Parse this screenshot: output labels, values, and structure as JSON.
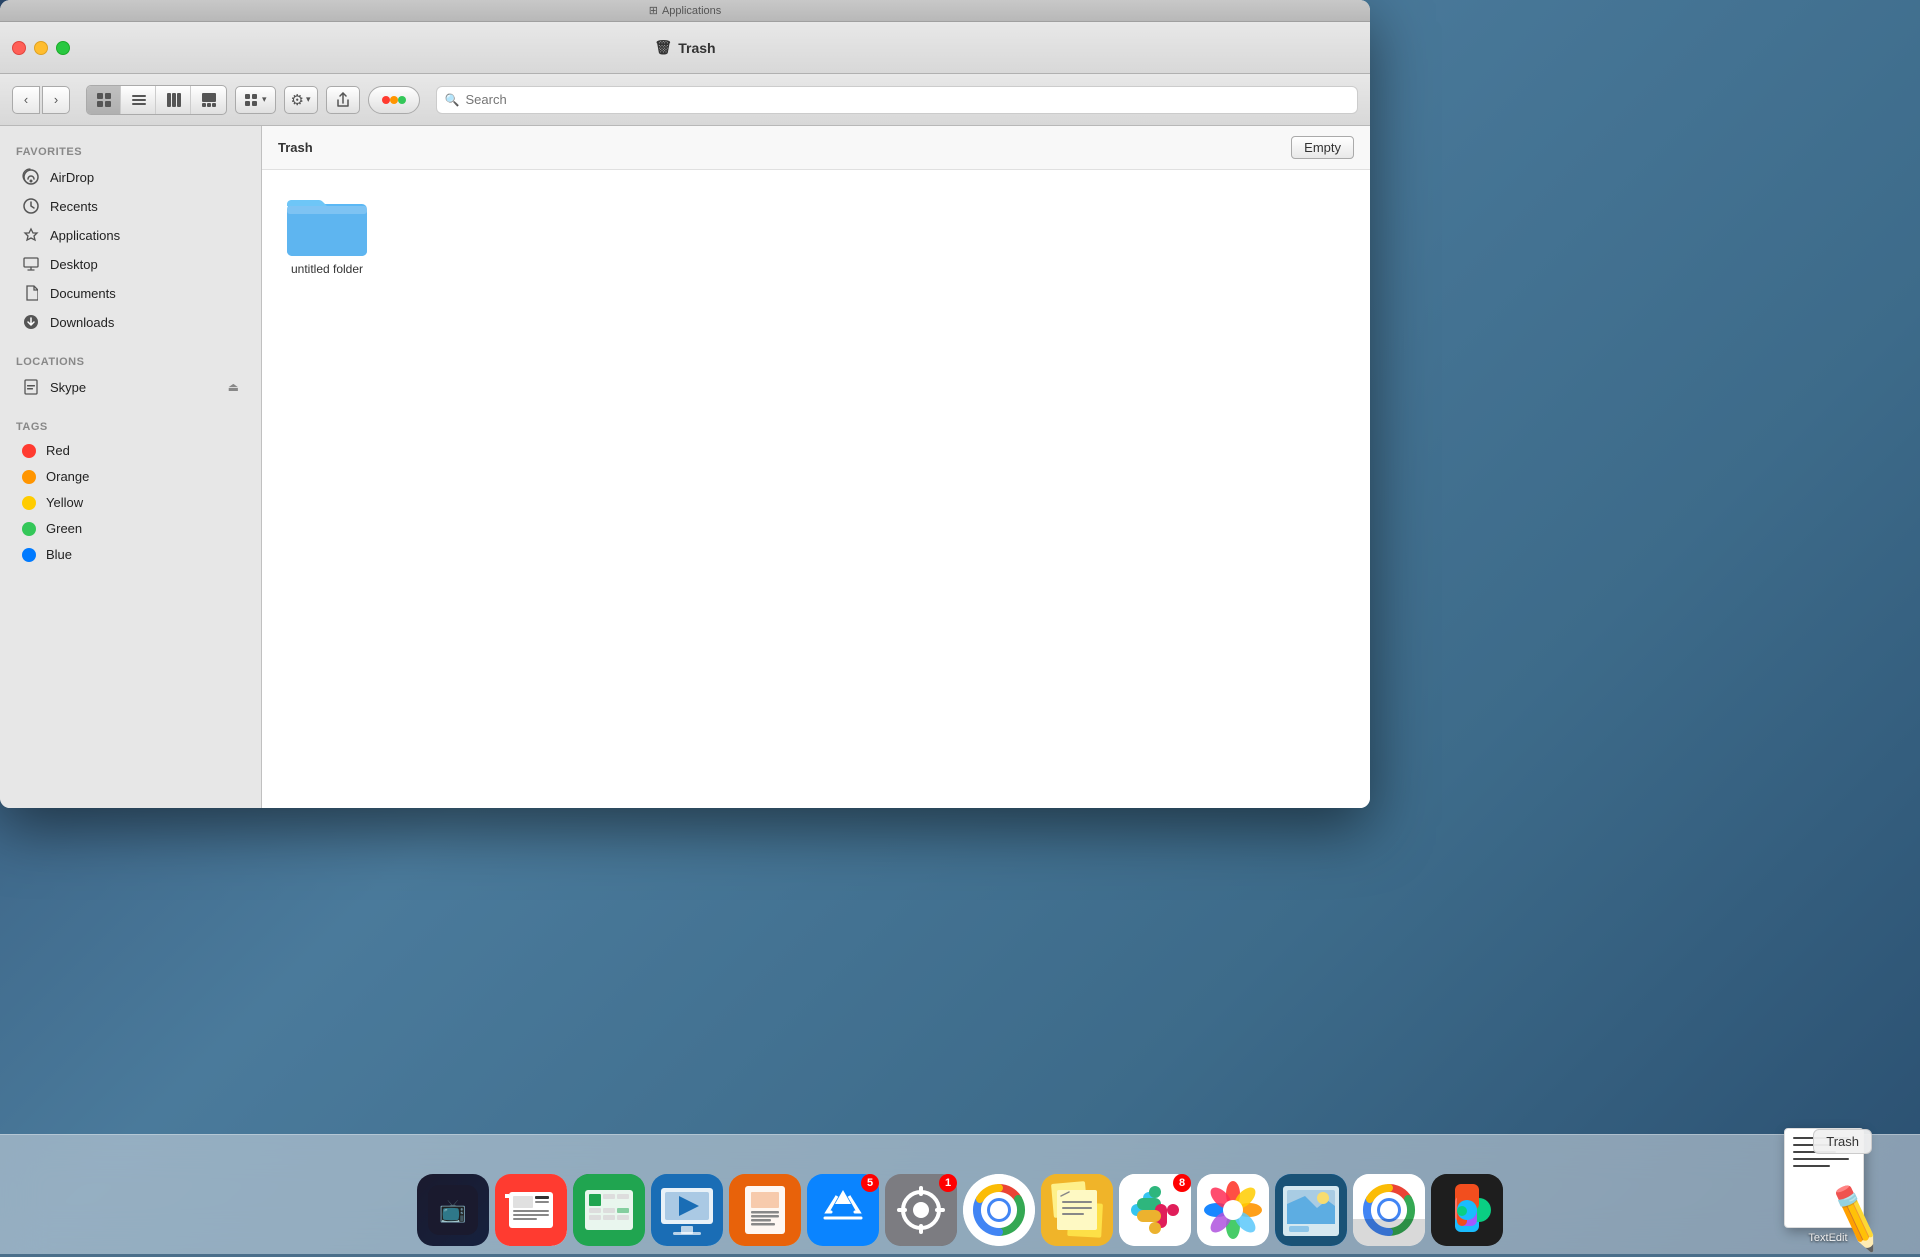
{
  "window": {
    "app_title": "Applications",
    "title": "Trash",
    "trash_icon": "🗑"
  },
  "toolbar": {
    "back_label": "‹",
    "forward_label": "›",
    "view_icon": "⊞",
    "view_list": "☰",
    "view_column": "⊟",
    "view_cover": "⊡",
    "group_label": "⊞",
    "chevron": "▾",
    "gear_icon": "⚙",
    "share_icon": "⬆",
    "tag_icon": "◯",
    "search_placeholder": "Search"
  },
  "sidebar": {
    "favorites_label": "Favorites",
    "locations_label": "Locations",
    "tags_label": "Tags",
    "items": [
      {
        "id": "airdrop",
        "label": "AirDrop",
        "icon": "📡"
      },
      {
        "id": "recents",
        "label": "Recents",
        "icon": "🕐"
      },
      {
        "id": "applications",
        "label": "Applications",
        "icon": "🚀"
      },
      {
        "id": "desktop",
        "label": "Desktop",
        "icon": "🖥"
      },
      {
        "id": "documents",
        "label": "Documents",
        "icon": "📄"
      },
      {
        "id": "downloads",
        "label": "Downloads",
        "icon": "⬇"
      }
    ],
    "locations": [
      {
        "id": "skype",
        "label": "Skype",
        "icon": "💾"
      }
    ],
    "tags": [
      {
        "id": "red",
        "label": "Red",
        "color": "#ff3b30"
      },
      {
        "id": "orange",
        "label": "Orange",
        "color": "#ff9500"
      },
      {
        "id": "yellow",
        "label": "Yellow",
        "color": "#ffcc00"
      },
      {
        "id": "green",
        "label": "Green",
        "color": "#34c759"
      },
      {
        "id": "blue",
        "label": "Blue",
        "color": "#007aff"
      }
    ]
  },
  "content": {
    "title": "Trash",
    "empty_button": "Empty",
    "folder_name": "untitled folder"
  },
  "dock": {
    "trash_label": "Trash",
    "trash_tooltip": "Trash",
    "items": [
      {
        "id": "appletv",
        "label": "",
        "icon": "📺",
        "bg": "#000"
      },
      {
        "id": "news",
        "label": "",
        "icon": "N",
        "bg": "#ff3b30"
      },
      {
        "id": "numbers",
        "label": "",
        "icon": "📊",
        "bg": "#1e7e34"
      },
      {
        "id": "keynote",
        "label": "",
        "icon": "🎞",
        "bg": "#1a6db5"
      },
      {
        "id": "pages",
        "label": "",
        "icon": "📝",
        "bg": "#f97316"
      },
      {
        "id": "appstore",
        "label": "",
        "icon": "A",
        "bg": "#0a84ff",
        "badge": "5"
      },
      {
        "id": "systemprefs",
        "label": "",
        "icon": "⚙",
        "bg": "#8e8e93",
        "badge": "1"
      },
      {
        "id": "chrome",
        "label": "",
        "icon": "🌐",
        "bg": "#fff"
      },
      {
        "id": "stickies",
        "label": "",
        "icon": "📋",
        "bg": "#fbbf24"
      },
      {
        "id": "slack",
        "label": "",
        "icon": "S",
        "bg": "#4a154b",
        "badge": "8"
      },
      {
        "id": "photos",
        "label": "",
        "icon": "📷",
        "bg": "#fff"
      },
      {
        "id": "preview2",
        "label": "",
        "icon": "🖼",
        "bg": "#1e88e5"
      },
      {
        "id": "chrome2",
        "label": "",
        "icon": "🌐",
        "bg": "#fff"
      },
      {
        "id": "figma",
        "label": "",
        "icon": "F",
        "bg": "#1e1e1e"
      }
    ]
  }
}
